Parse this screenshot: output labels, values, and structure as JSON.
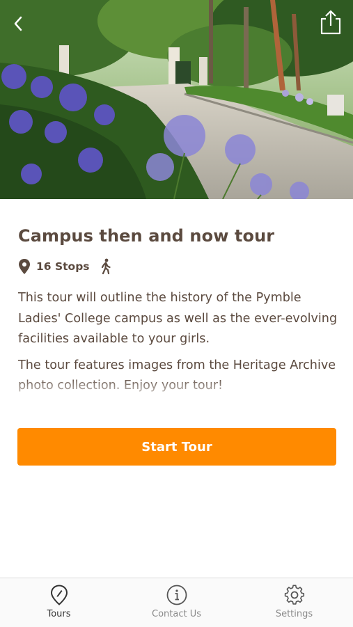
{
  "hero": {
    "image_description": "",
    "back_icon": "chevron-left-icon",
    "share_icon": "share-icon"
  },
  "tour": {
    "title": "Campus then and now tour",
    "stops": "16 Stops",
    "stops_icon": "map-pin-icon",
    "mode_icon": "walking-icon",
    "description_1": "This tour will outline the history of the Pymble Ladies' College campus as well as the ever-evolving facilities available to your girls.",
    "description_2": "The tour features images from the Heritage Archive photo collection. Enjoy your tour!"
  },
  "actions": {
    "start_label": "Start Tour"
  },
  "tabs": [
    {
      "label": "Tours",
      "icon": "pin-tours-icon",
      "active": true
    },
    {
      "label": "Contact Us",
      "icon": "info-icon",
      "active": false
    },
    {
      "label": "Settings",
      "icon": "gear-icon",
      "active": false
    }
  ],
  "colors": {
    "accent": "#ff8a00",
    "text": "#5b4a3f",
    "tab_inactive": "#8a8a8a"
  }
}
